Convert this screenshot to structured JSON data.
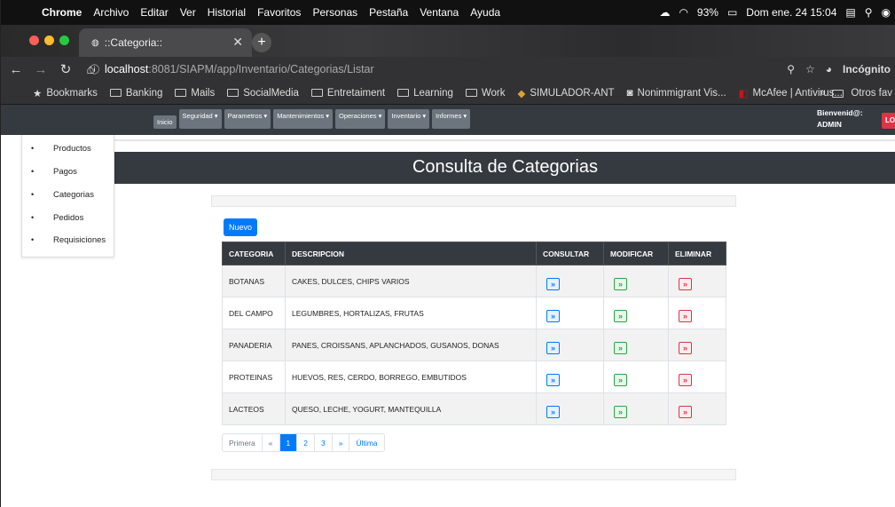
{
  "macos": {
    "menu": [
      "Chrome",
      "Archivo",
      "Editar",
      "Ver",
      "Historial",
      "Favoritos",
      "Personas",
      "Pestaña",
      "Ventana",
      "Ayuda"
    ],
    "battery": "93%",
    "clock": "Dom ene. 24 15:04"
  },
  "browser": {
    "tab_title": "::Categoria::",
    "url_host": "localhost",
    "url_path": ":8081/SIAPM/app/Inventario/Categorias/Listar",
    "profile": "Incógnito",
    "bookmarks": [
      "Bookmarks",
      "Banking",
      "Mails",
      "SocialMedia",
      "Entretaiment",
      "Learning",
      "Work",
      "SIMULADOR-ANT",
      "Nonimmigrant Vis...",
      "McAfee | Antivirus..."
    ],
    "other_bookmarks": "Otros fav"
  },
  "app": {
    "nav_home": "Inicio",
    "nav_menus": [
      "Seguridad ▾",
      "Parametros ▾",
      "Mantenimientos ▾",
      "Operaciones ▾",
      "Inventario ▾",
      "Informes ▾"
    ],
    "welcome": "Bienvenid@:",
    "user": "ADMIN",
    "logout": "LO",
    "dropdown_items": [
      "Productos",
      "Pagos",
      "Categorias",
      "Pedidos",
      "Requisiciones"
    ],
    "page_title": "Consulta de Categorias",
    "new_button": "Nuevo",
    "table": {
      "headers": [
        "CATEGORIA",
        "DESCRIPCION",
        "CONSULTAR",
        "MODIFICAR",
        "ELIMINAR"
      ],
      "rows": [
        [
          "BOTANAS",
          "CAKES, DULCES, CHIPS VARIOS"
        ],
        [
          "DEL CAMPO",
          "LEGUMBRES, HORTALIZAS, FRUTAS"
        ],
        [
          "PANADERIA",
          "PANES, CROISSANS, APLANCHADOS, GUSANOS, DONAS"
        ],
        [
          "PROTEINAS",
          "HUEVOS, RES, CERDO, BORREGO, EMBUTIDOS"
        ],
        [
          "LACTEOS",
          "QUESO, LECHE, YOGURT, MANTEQUILLA"
        ]
      ],
      "action_glyph": "»"
    },
    "pagination": [
      "Primera",
      "«",
      "1",
      "2",
      "3",
      "»",
      "Última"
    ],
    "current_page": "1"
  }
}
